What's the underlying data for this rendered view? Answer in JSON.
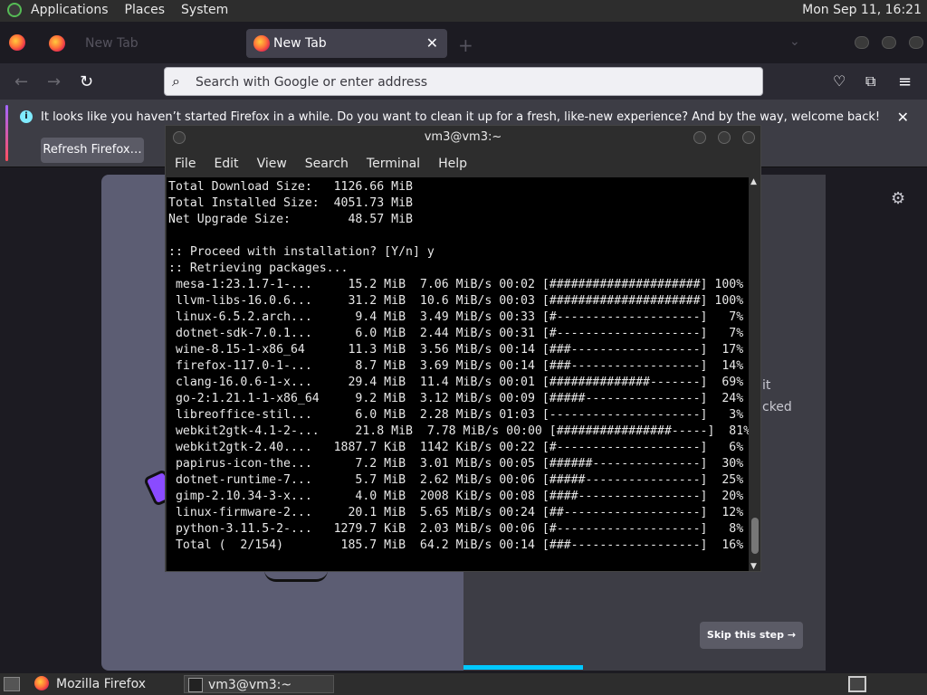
{
  "topbar": {
    "menus": [
      "Applications",
      "Places",
      "System"
    ],
    "clock": "Mon Sep 11, 16:21"
  },
  "browser": {
    "tabs": [
      {
        "label": "New Tab",
        "active": false
      },
      {
        "label": "New Tab",
        "active": true
      }
    ],
    "new_tab_symbol": "+",
    "urlbar_placeholder": "Search with Google or enter address",
    "notification": {
      "message": "It looks like you haven’t started Firefox in a while. Do you want to clean it up for a fresh, like-new experience? And by the way, welcome back!",
      "button": "Refresh Firefox…"
    },
    "welcome": {
      "partial_text_1": "it",
      "partial_text_2": "cked",
      "skip_button": "Skip this step →",
      "progress": 0.33
    }
  },
  "terminal": {
    "title": "vm3@vm3:~",
    "menu": [
      "File",
      "Edit",
      "View",
      "Search",
      "Terminal",
      "Help"
    ],
    "lines": [
      "Total Download Size:   1126.66 MiB",
      "Total Installed Size:  4051.73 MiB",
      "Net Upgrade Size:        48.57 MiB",
      "",
      ":: Proceed with installation? [Y/n] y",
      ":: Retrieving packages...",
      " mesa-1:23.1.7-1-...     15.2 MiB  7.06 MiB/s 00:02 [#####################] 100%",
      " llvm-libs-16.0.6...     31.2 MiB  10.6 MiB/s 00:03 [#####################] 100%",
      " linux-6.5.2.arch...      9.4 MiB  3.49 MiB/s 00:33 [#--------------------]   7%",
      " dotnet-sdk-7.0.1...      6.0 MiB  2.44 MiB/s 00:31 [#--------------------]   7%",
      " wine-8.15-1-x86_64      11.3 MiB  3.56 MiB/s 00:14 [###------------------]  17%",
      " firefox-117.0-1-...      8.7 MiB  3.69 MiB/s 00:14 [###------------------]  14%",
      " clang-16.0.6-1-x...     29.4 MiB  11.4 MiB/s 00:01 [##############-------]  69%",
      " go-2:1.21.1-1-x86_64     9.2 MiB  3.12 MiB/s 00:09 [#####----------------]  24%",
      " libreoffice-stil...      6.0 MiB  2.28 MiB/s 01:03 [---------------------]   3%",
      " webkit2gtk-4.1-2-...     21.8 MiB  7.78 MiB/s 00:00 [################-----]  81%",
      " webkit2gtk-2.40....   1887.7 KiB  1142 KiB/s 00:22 [#--------------------]   6%",
      " papirus-icon-the...      7.2 MiB  3.01 MiB/s 00:05 [######---------------]  30%",
      " dotnet-runtime-7...      5.7 MiB  2.62 MiB/s 00:06 [#####----------------]  25%",
      " gimp-2.10.34-3-x...      4.0 MiB  2008 KiB/s 00:08 [####-----------------]  20%",
      " linux-firmware-2...     20.1 MiB  5.65 MiB/s 00:24 [##-------------------]  12%",
      " python-3.11.5-2-...   1279.7 KiB  2.03 MiB/s 00:06 [#--------------------]   8%",
      " Total (  2/154)        185.7 MiB  64.2 MiB/s 00:14 [###------------------]  16%"
    ],
    "scrollbar_up": "▲",
    "scrollbar_down": "▼"
  },
  "taskbar": {
    "items": [
      {
        "label": "Mozilla Firefox"
      },
      {
        "label": "vm3@vm3:~"
      }
    ]
  },
  "colors": {
    "accent": "#00c8ff",
    "terminal_bg": "#000000",
    "terminal_fg": "#e8e8e8",
    "browser_bg": "#1c1b22"
  }
}
